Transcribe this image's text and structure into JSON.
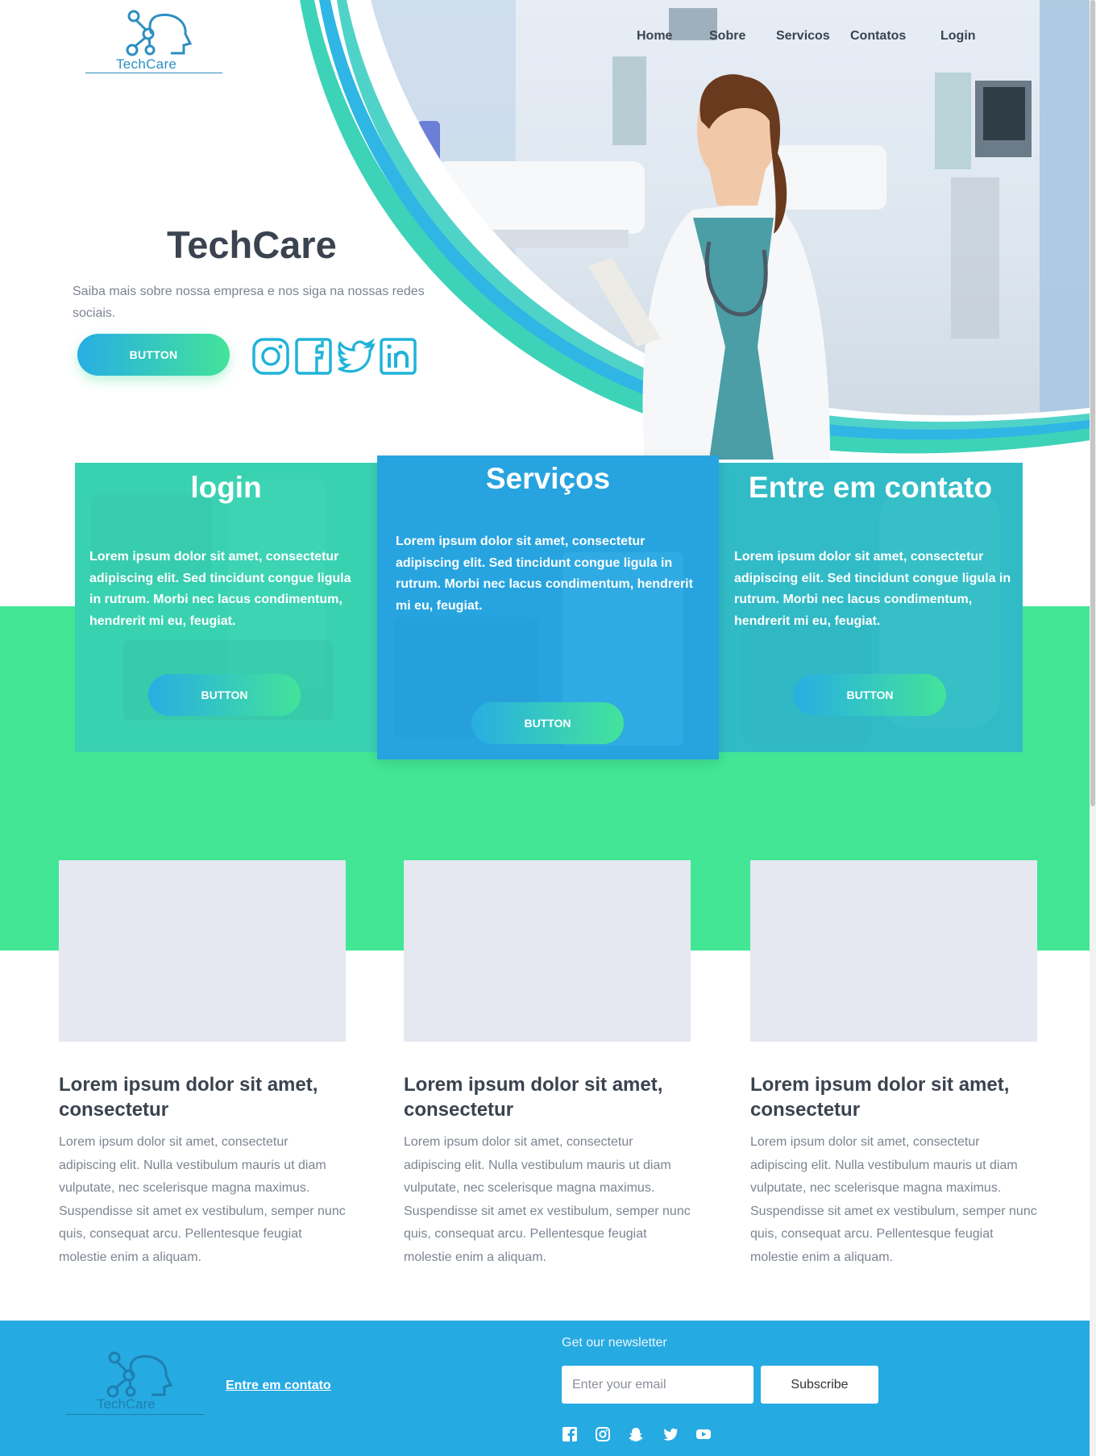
{
  "brand": {
    "name": "TechCare"
  },
  "nav": {
    "items": [
      "Home",
      "Sobre",
      "Servicos",
      "Contatos",
      "Login"
    ]
  },
  "hero": {
    "title": "TechCare",
    "subtitle": "Saiba mais sobre nossa empresa e nos siga na nossas redes sociais.",
    "button_label": "BUTTON",
    "social_icons": [
      "instagram-icon",
      "facebook-icon",
      "twitter-icon",
      "linkedin-icon"
    ]
  },
  "cards": [
    {
      "title": "login",
      "text": "Lorem ipsum dolor sit amet, consectetur adipiscing elit. Sed tincidunt congue ligula in rutrum. Morbi nec lacus condimentum, hendrerit mi eu, feugiat.",
      "button_label": "BUTTON"
    },
    {
      "title": "Serviços",
      "text": "Lorem ipsum dolor sit amet, consectetur adipiscing elit. Sed tincidunt congue ligula in rutrum. Morbi nec lacus condimentum, hendrerit mi eu, feugiat.",
      "button_label": "BUTTON"
    },
    {
      "title": "Entre em contato",
      "text": "Lorem ipsum dolor sit amet, consectetur adipiscing elit. Sed tincidunt congue ligula in rutrum. Morbi nec lacus condimentum, hendrerit mi eu, feugiat.",
      "button_label": "BUTTON"
    }
  ],
  "articles": [
    {
      "title": "Lorem ipsum dolor sit amet, consectetur",
      "body": "Lorem ipsum dolor sit amet, consectetur adipiscing elit. Nulla vestibulum mauris ut diam vulputate, nec scelerisque magna maximus. Suspendisse sit amet ex vestibulum, semper nunc quis, consequat arcu. Pellentesque feugiat molestie enim a aliquam."
    },
    {
      "title": "Lorem ipsum dolor sit amet, consectetur",
      "body": "Lorem ipsum dolor sit amet, consectetur adipiscing elit. Nulla vestibulum mauris ut diam vulputate, nec scelerisque magna maximus. Suspendisse sit amet ex vestibulum, semper nunc quis, consequat arcu. Pellentesque feugiat molestie enim a aliquam."
    },
    {
      "title": "Lorem ipsum dolor sit amet, consectetur",
      "body": "Lorem ipsum dolor sit amet, consectetur adipiscing elit. Nulla vestibulum mauris ut diam vulputate, nec scelerisque magna maximus. Suspendisse sit amet ex vestibulum, semper nunc quis, consequat arcu. Pellentesque feugiat molestie enim a aliquam."
    }
  ],
  "footer": {
    "brand": "TechCare",
    "contact_label": "Entre em contato",
    "newsletter_label": "Get our newsletter",
    "email_placeholder": "Enter your email",
    "subscribe_label": "Subscribe",
    "social_icons": [
      "facebook-icon",
      "instagram-icon",
      "snapchat-icon",
      "twitter-icon",
      "youtube-icon"
    ]
  },
  "colors": {
    "accent_green": "#42e695",
    "accent_blue": "#26aae2",
    "teal_card": "#2fc9b0",
    "text_dark": "#3b4350",
    "text_muted": "#7c8491",
    "thumb_gray": "#e5e8f0"
  }
}
